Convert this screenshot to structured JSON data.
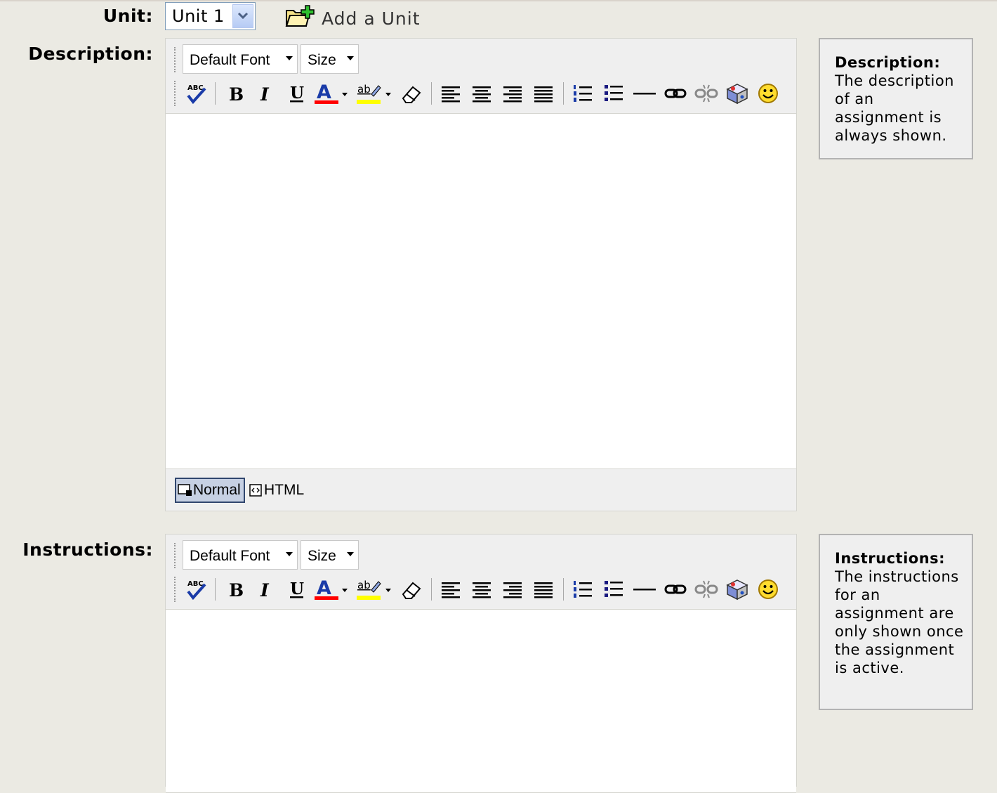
{
  "unit": {
    "label": "Unit:",
    "selected": "Unit 1",
    "add_label": "Add a Unit"
  },
  "description": {
    "label": "Description:",
    "font_combo": "Default Font",
    "size_combo": "Size",
    "content": "",
    "mode_normal": "Normal",
    "mode_html": "HTML",
    "help_title": "Description:",
    "help_text": "The description of an assignment is always shown."
  },
  "instructions": {
    "label": "Instructions:",
    "font_combo": "Default Font",
    "size_combo": "Size",
    "content": "",
    "help_title": "Instructions:",
    "help_text": "The instructions for an assignment are only shown once the assignment is active."
  },
  "toolbar_icons": [
    "spellcheck-icon",
    "bold-icon",
    "italic-icon",
    "underline-icon",
    "font-color-icon",
    "highlight-color-icon",
    "eraser-icon",
    "align-left-icon",
    "align-center-icon",
    "align-right-icon",
    "justify-icon",
    "ordered-list-icon",
    "unordered-list-icon",
    "horizontal-rule-icon",
    "link-icon",
    "unlink-icon",
    "insert-media-icon",
    "emoticon-icon"
  ],
  "colors": {
    "page_bg": "#ebeae3",
    "toolbar_bg": "#efefef",
    "font_color_bar": "#ff0000",
    "highlight_bar": "#ffff00",
    "mode_active_border": "#30466e"
  }
}
